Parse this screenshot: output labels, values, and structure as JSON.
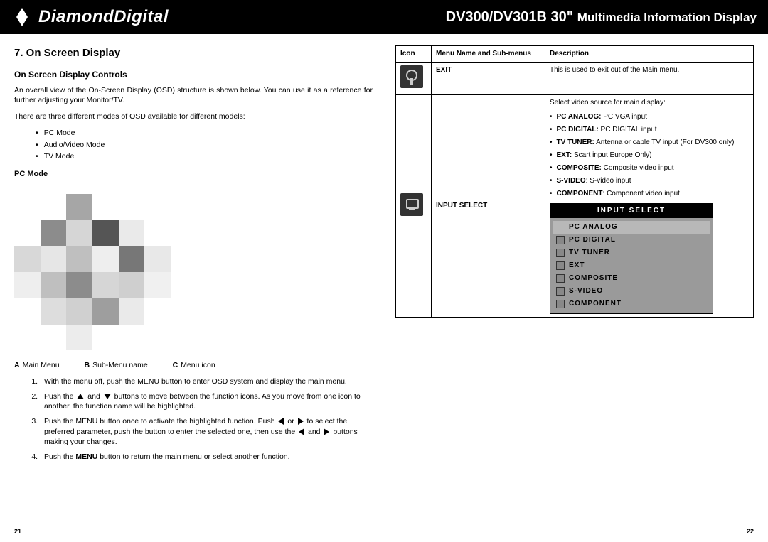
{
  "header": {
    "brand": "DiamondDigital",
    "model_main": "DV300/DV301B 30\"",
    "model_sub": "Multimedia Information Display"
  },
  "left": {
    "title": "7. On Screen Display",
    "sub": "On Screen Display Controls",
    "intro": "An overall view of the On-Screen Display (OSD) structure is shown below. You can use it as a reference for further adjusting your Monitor/TV.",
    "modes_intro": "There are three different modes of OSD available for different models:",
    "modes": [
      "PC Mode",
      "Audio/Video Mode",
      "TV Mode"
    ],
    "pc_mode_title": "PC Mode",
    "legend": {
      "a": "Main Menu",
      "b": "Sub-Menu name",
      "c": "Menu icon"
    },
    "step1": "With the menu off, push the MENU button to enter OSD system and display the main menu.",
    "step2a": "Push the ",
    "step2b": " and ",
    "step2c": " buttons to move between the function icons. As you move from one icon to another, the function name will be highlighted.",
    "step3a": "Push the MENU button once to activate the highlighted function. Push ",
    "step3b": " or ",
    "step3c": " to select the preferred parameter, push the  button to enter the selected one, then use the ",
    "step3d": " and ",
    "step3e": " buttons making your changes.",
    "step4a": "Push the ",
    "step4b": "MENU",
    "step4c": " button to return the main menu or select another function.",
    "page_no": "21"
  },
  "right": {
    "th_icon": "Icon",
    "th_menu": "Menu Name and Sub-menus",
    "th_desc": "Description",
    "row_exit_name": "EXIT",
    "row_exit_desc": "This is used to exit out of the Main menu.",
    "row_input_name": "INPUT SELECT",
    "row_input_intro": "Select video source for main display:",
    "inputs": [
      {
        "label": "PC ANALOG:",
        "desc": " PC VGA input"
      },
      {
        "label": "PC DIGITAL:",
        "desc": " PC DIGITAL input"
      },
      {
        "label": "TV TUNER:",
        "desc": " Antenna or cable TV input (For DV300 only)"
      },
      {
        "label": "EXT:",
        "desc": " Scart input  Europe Only)"
      },
      {
        "label": "COMPOSITE:",
        "desc": " Composite video input"
      },
      {
        "label": "S-VIDEO",
        "desc": ": S-video input"
      },
      {
        "label": "COMPONENT",
        "desc": ": Component video input"
      }
    ],
    "osd_panel_title": "INPUT SELECT",
    "osd_items": [
      "PC ANALOG",
      "PC DIGITAL",
      "TV TUNER",
      "EXT",
      "COMPOSITE",
      "S-VIDEO",
      "COMPONENT"
    ],
    "page_no": "22"
  }
}
